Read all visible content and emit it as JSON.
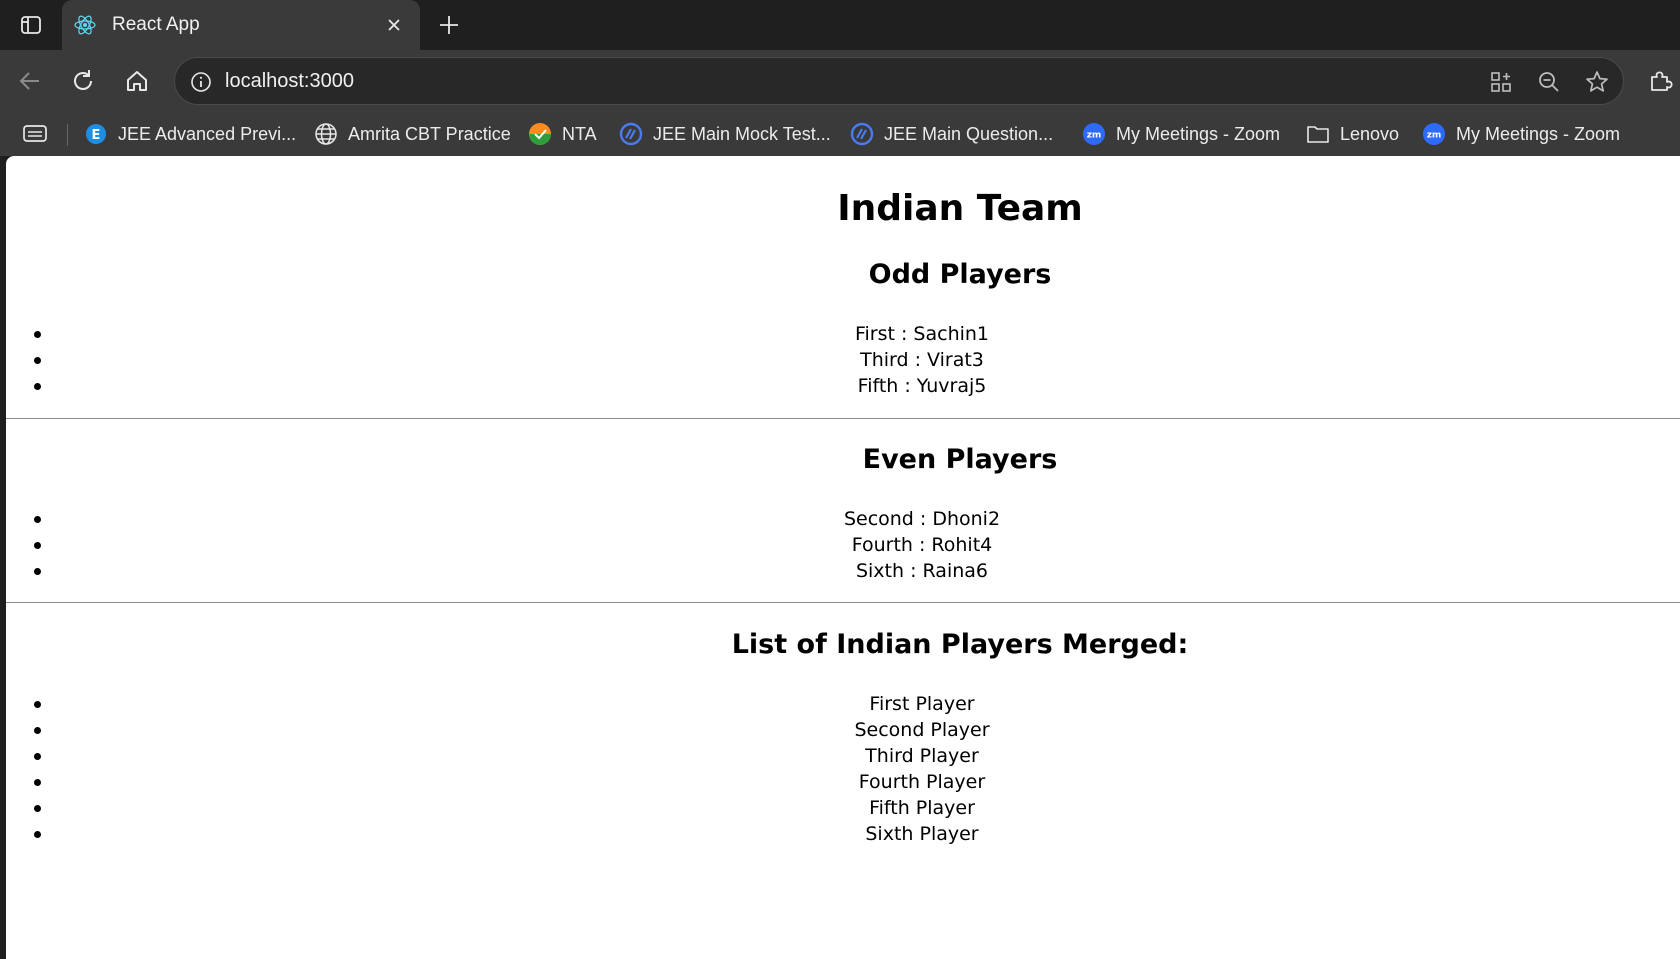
{
  "browser": {
    "tab": {
      "title": "React App"
    },
    "address": {
      "url": "localhost:3000"
    },
    "bookmarks": [
      {
        "label": "JEE Advanced Previ...",
        "icon": "edge-e-icon"
      },
      {
        "label": "Amrita CBT Practice",
        "icon": "globe-icon"
      },
      {
        "label": "NTA",
        "icon": "nta-logo-icon"
      },
      {
        "label": "JEE Main Mock Test...",
        "icon": "ring-logo-icon"
      },
      {
        "label": "JEE Main Question...",
        "icon": "ring-logo-icon"
      },
      {
        "label": "My Meetings - Zoom",
        "icon": "zoom-icon"
      },
      {
        "label": "Lenovo",
        "icon": "folder-icon"
      },
      {
        "label": "My Meetings - Zoom",
        "icon": "zoom-icon"
      }
    ]
  },
  "page": {
    "title": "Indian Team",
    "odd": {
      "heading": "Odd Players",
      "items": [
        "First : Sachin1",
        "Third : Virat3",
        "Fifth : Yuvraj5"
      ]
    },
    "even": {
      "heading": "Even Players",
      "items": [
        "Second : Dhoni2",
        "Fourth : Rohit4",
        "Sixth : Raina6"
      ]
    },
    "merged": {
      "heading": "List of Indian Players Merged:",
      "items": [
        "First Player",
        "Second Player",
        "Third Player",
        "Fourth Player",
        "Fifth Player",
        "Sixth Player"
      ]
    }
  },
  "colors": {
    "chrome_dark": "#1f1f1f",
    "chrome": "#3a3a3a",
    "page_bg": "#ffffff"
  }
}
